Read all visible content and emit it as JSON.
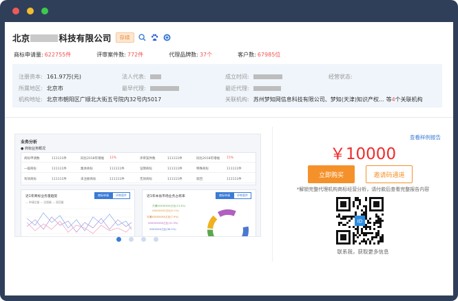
{
  "company": {
    "name_prefix": "北京",
    "name_suffix": "科技有限公司",
    "status": "存续",
    "icons": [
      "search-icon",
      "baidu-paw-icon",
      "link-icon"
    ]
  },
  "stats": [
    {
      "label": "商标申请量:",
      "value": "622755件"
    },
    {
      "label": "评审案件数:",
      "value": "772件"
    },
    {
      "label": "代理品牌数:",
      "value": "37个"
    },
    {
      "label": "客户数:",
      "value": "67985位"
    }
  ],
  "info": {
    "capital_label": "注册资本:",
    "capital_value": "161.97万(元)",
    "legal_label": "法人代表:",
    "founded_label": "成立时间:",
    "status_label": "经营状态:",
    "region_label": "所属地区:",
    "region_value": "北京市",
    "earliest_agent_label": "最早代理:",
    "latest_agent_label": "最近代理:",
    "address_label": "机构地址:",
    "address_value": "北京市朝阳区广顺北大街五号院内32号内5017",
    "related_label": "关联机构:",
    "related_value": "苏州梦知网信息科技有限公司、梦知(天津)知识产权...",
    "related_more_prefix": "等",
    "related_more_count": "4",
    "related_more_suffix": "个关联机构"
  },
  "preview": {
    "title": "业务分析",
    "subtitle": "● 商标业务概况",
    "rows": [
      [
        "商标申请数",
        "111111件",
        "同比2018年增幅",
        "12%",
        "评审案件数",
        "111111件",
        "同比2018年增幅",
        "15%"
      ],
      [
        "一般商标",
        "111111件",
        "集体商标",
        "111111件",
        "证明商标",
        "111111件",
        "特殊商标",
        "111111件"
      ],
      [
        "有效商标",
        "111111件",
        "未注册商标",
        "111111件",
        "无效商标",
        "111111件",
        "驳回",
        "111111件"
      ]
    ],
    "chart1": {
      "title": "近1年商标业务量趋势",
      "tab_on": "商标申请",
      "tab_off": "评审案件",
      "legend": "— 申请总量  — 注册量  — 驳回量"
    },
    "chart2": {
      "title": "近1年本省市场业务占有率",
      "tab_on": "商标申请",
      "tab_off": "评审案件",
      "labels": [
        "万通XXXXXXXX占比(13.4%)",
        "XXXXXXXX占比(9.1%)",
        "万通XXXXXXXX占比(7.9%)",
        "XXXXXXXXX占比(31.3%)",
        "XXXXXXX占比(38.2%)"
      ]
    }
  },
  "carousel": {
    "count": 4,
    "active": 0
  },
  "purchase": {
    "sample_link": "查看样例报告",
    "price": "￥10000",
    "buy_label": "立即购买",
    "invite_label": "邀请码通道",
    "note": "*解锁完整代理机构商标经营分析，请付款后查看完整报告内容",
    "contact": "联系我，获取更多信息"
  },
  "colors": {
    "accent": "#3a7bd5",
    "price": "#f22b2b",
    "buy": "#f5912a",
    "highlight": "#f05050"
  }
}
